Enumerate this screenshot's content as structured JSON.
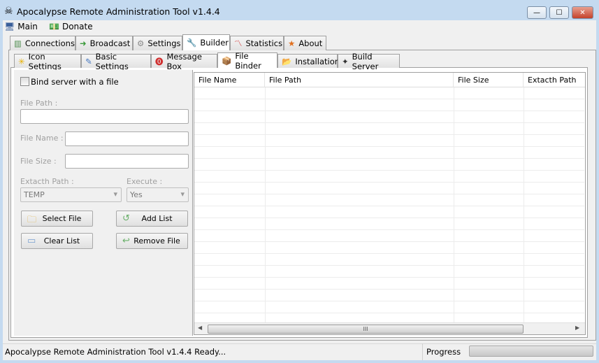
{
  "window": {
    "title": "Apocalypse Remote Administration Tool v1.4.4"
  },
  "menu": [
    {
      "label": "Main",
      "icon": "monitor-icon"
    },
    {
      "label": "Donate",
      "icon": "money-icon"
    }
  ],
  "main_tabs": [
    {
      "label": "Connections"
    },
    {
      "label": "Broadcast"
    },
    {
      "label": "Settings"
    },
    {
      "label": "Builder",
      "active": true
    },
    {
      "label": "Statistics"
    },
    {
      "label": "About"
    }
  ],
  "builder_tabs": [
    {
      "label": "Icon Settings"
    },
    {
      "label": "Basic Settings"
    },
    {
      "label": "Message Box"
    },
    {
      "label": "File Binder",
      "active": true
    },
    {
      "label": "Installation"
    },
    {
      "label": "Build Server"
    }
  ],
  "binder": {
    "bind_checkbox": "Bind server with a file",
    "bind_checked": false,
    "file_path_label": "File Path :",
    "file_path": "",
    "file_name_label": "File Name :",
    "file_name": "",
    "file_size_label": "File Size :",
    "file_size": "",
    "extract_path_label": "Extacth Path :",
    "extract_path": "TEMP",
    "execute_label": "Execute :",
    "execute": "Yes",
    "select_file": "Select File",
    "add_list": "Add List",
    "clear_list": "Clear List",
    "remove_file": "Remove File"
  },
  "grid": {
    "columns": [
      "File Name",
      "File Path",
      "File Size",
      "Extacth Path"
    ],
    "rows": [],
    "scroll_grip": "III"
  },
  "status": {
    "text": "Apocalypse Remote Administration Tool v1.4.4 Ready...",
    "progress_label": "Progress",
    "progress": 0
  }
}
